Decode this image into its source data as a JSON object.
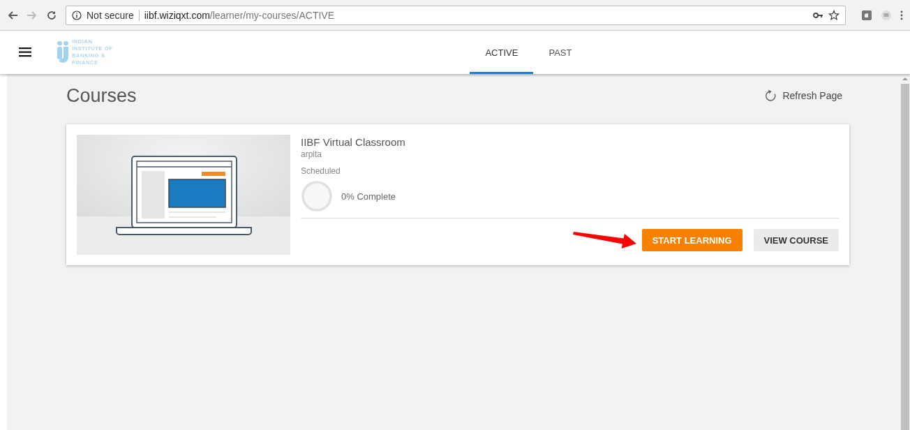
{
  "browser": {
    "security": "Not secure",
    "url_host": "iibf.wiziqxt.com",
    "url_path": "/learner/my-courses/ACTIVE"
  },
  "header": {
    "logo_lines": [
      "INDIAN",
      "INSTITUTE OF",
      "BANKING  &",
      "FINANCE"
    ],
    "tabs": [
      {
        "label": "ACTIVE",
        "selected": true
      },
      {
        "label": "PAST",
        "selected": false
      }
    ]
  },
  "page": {
    "title": "Courses",
    "refresh": "Refresh Page"
  },
  "courses": [
    {
      "title": "IIBF Virtual Classroom",
      "author": "arpita",
      "status": "Scheduled",
      "progress": {
        "level": 0,
        "label": "0% Complete"
      },
      "buttons": [
        {
          "label": "START LEARNING",
          "kind": "primary"
        },
        {
          "label": "VIEW COURSE",
          "kind": "secondary"
        }
      ]
    }
  ]
}
